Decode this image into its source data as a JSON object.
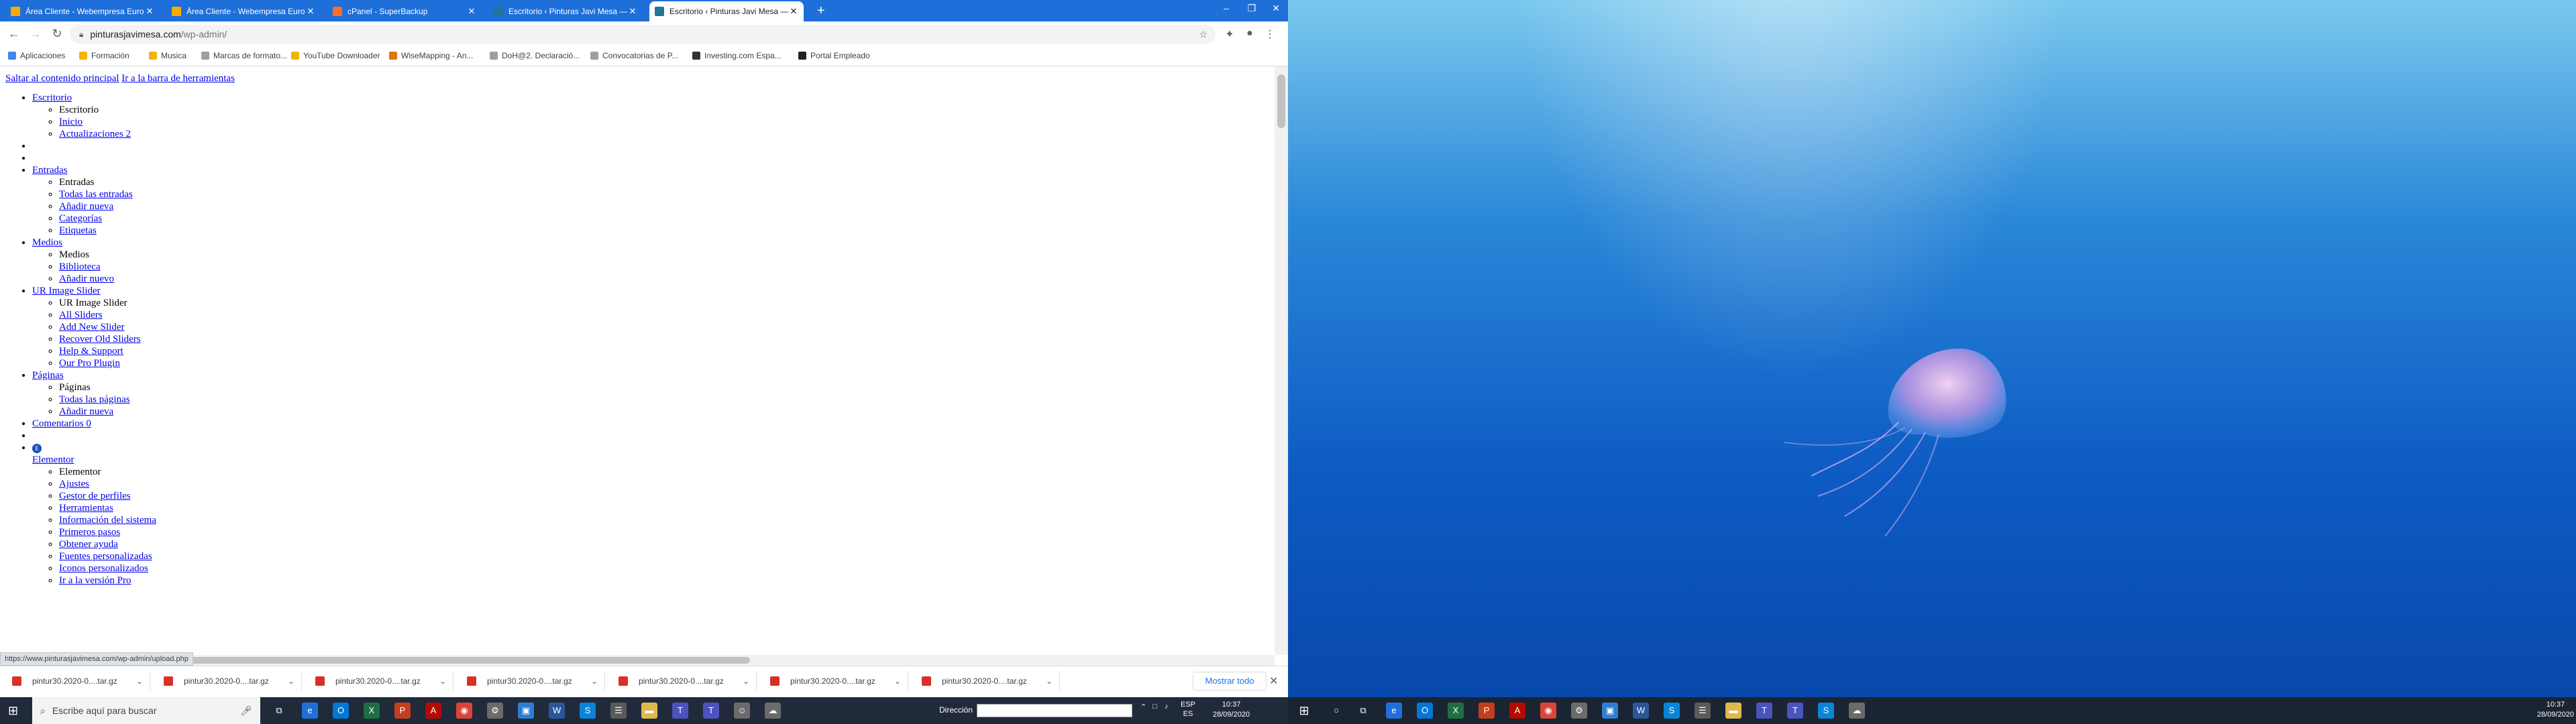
{
  "browser": {
    "tabs": [
      {
        "title": "Área Cliente - Webempresa Euro",
        "favicon_color": "#f9ab00"
      },
      {
        "title": "Área Cliente - Webempresa Euro",
        "favicon_color": "#f9ab00"
      },
      {
        "title": "cPanel - SuperBackup",
        "favicon_color": "#ff6c2c"
      },
      {
        "title": "Escritorio ‹ Pinturas Javi Mesa —",
        "favicon_color": "#21759b"
      },
      {
        "title": "Escritorio ‹ Pinturas Javi Mesa —",
        "favicon_color": "#21759b",
        "active": true
      }
    ],
    "url_host": "pinturasjavimesa.com",
    "url_path": "/wp-admin/",
    "bookmarks": [
      {
        "label": "Aplicaciones",
        "color": "#4285f4"
      },
      {
        "label": "Formación",
        "color": "#f4b400"
      },
      {
        "label": "Musica",
        "color": "#f4b400"
      },
      {
        "label": "Marcas de formato...",
        "color": "#9aa0a6"
      },
      {
        "label": "YouTube Downloader",
        "color": "#f4b400"
      },
      {
        "label": "WiseMapping - An...",
        "color": "#e37400"
      },
      {
        "label": "DoH@2. Declaració...",
        "color": "#9aa0a6"
      },
      {
        "label": "Convocatorias de P...",
        "color": "#9aa0a6"
      },
      {
        "label": "Investing.com Espa...",
        "color": "#333333"
      },
      {
        "label": "Portal Empleado",
        "color": "#202124"
      }
    ]
  },
  "page": {
    "skip_links": [
      "Saltar al contenido principal",
      "Ir a la barra de herramientas"
    ],
    "menu": [
      {
        "label": "Escritorio",
        "sub": [
          {
            "label": "Escritorio",
            "link": false
          },
          {
            "label": "Inicio",
            "link": true
          },
          {
            "label": "Actualizaciones 2",
            "link": true
          }
        ]
      },
      {
        "empty": true
      },
      {
        "empty": true
      },
      {
        "label": "Entradas",
        "sub": [
          {
            "label": "Entradas",
            "link": false
          },
          {
            "label": "Todas las entradas",
            "link": true
          },
          {
            "label": "Añadir nueva",
            "link": true
          },
          {
            "label": "Categorías",
            "link": true
          },
          {
            "label": "Etiquetas",
            "link": true
          }
        ]
      },
      {
        "label": "Medios",
        "sub": [
          {
            "label": "Medios",
            "link": false
          },
          {
            "label": "Biblioteca",
            "link": true
          },
          {
            "label": "Añadir nuevo",
            "link": true
          }
        ]
      },
      {
        "label": "UR Image Slider",
        "sub": [
          {
            "label": "UR Image Slider",
            "link": false
          },
          {
            "label": "All Sliders",
            "link": true
          },
          {
            "label": "Add New Slider",
            "link": true
          },
          {
            "label": "Recover Old Sliders",
            "link": true
          },
          {
            "label": "Help & Support",
            "link": true
          },
          {
            "label": "Our Pro Plugin",
            "link": true
          }
        ]
      },
      {
        "label": "Páginas",
        "sub": [
          {
            "label": "Páginas",
            "link": false
          },
          {
            "label": "Todas las páginas",
            "link": true
          },
          {
            "label": "Añadir nueva",
            "link": true
          }
        ]
      },
      {
        "label": "Comentarios 0",
        "sub": []
      },
      {
        "empty": true
      },
      {
        "label": "Elementor",
        "icon": true,
        "sub": [
          {
            "label": "Elementor",
            "link": false
          },
          {
            "label": "Ajustes",
            "link": true
          },
          {
            "label": "Gestor de perfiles",
            "link": true
          },
          {
            "label": "Herramientas",
            "link": true
          },
          {
            "label": "Información del sistema",
            "link": true
          },
          {
            "label": "Primeros pasos",
            "link": true
          },
          {
            "label": "Obtener ayuda",
            "link": true
          },
          {
            "label": "Fuentes personalizadas",
            "link": true
          },
          {
            "label": "Iconos personalizados",
            "link": true
          },
          {
            "label": "Ir a la versión Pro",
            "link": true
          }
        ]
      }
    ],
    "status_url": "https://www.pinturasjavimesa.com/wp-admin/upload.php"
  },
  "downloads": {
    "items": [
      "pintur30.2020-0....tar.gz",
      "pintur30.2020-0....tar.gz",
      "pintur30.2020-0....tar.gz",
      "pintur30.2020-0....tar.gz",
      "pintur30.2020-0....tar.gz",
      "pintur30.2020-0....tar.gz",
      "pintur30.2020-0....tar.gz"
    ],
    "show_all": "Mostrar todo"
  },
  "taskbar": {
    "search_placeholder": "Escribe aquí para buscar",
    "address_label": "Dirección",
    "lang": "ESP",
    "lang_sub": "ES",
    "time": "10:37",
    "date": "28/09/2020"
  }
}
